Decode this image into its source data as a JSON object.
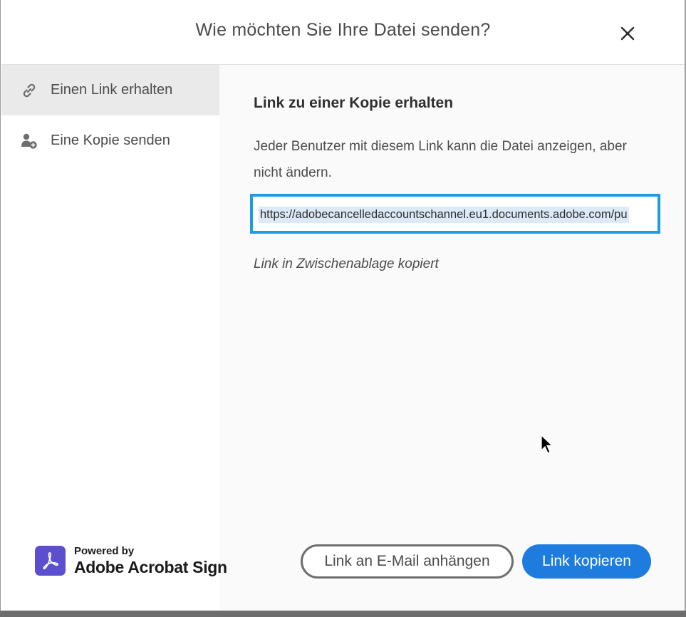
{
  "dialog": {
    "title": "Wie möchten Sie Ihre Datei senden?",
    "close_icon": "close-icon"
  },
  "sidebar": {
    "items": [
      {
        "label": "Einen Link erhalten",
        "icon": "link-icon",
        "active": true
      },
      {
        "label": "Eine Kopie senden",
        "icon": "add-user-icon",
        "active": false
      }
    ]
  },
  "main": {
    "heading": "Link zu einer Kopie erhalten",
    "description": "Jeder Benutzer mit diesem Link kann die Datei anzeigen, aber nicht ändern.",
    "link_value": "https://adobecancelledaccountschannel.eu1.documents.adobe.com/pu",
    "status": "Link in Zwischenablage kopiert"
  },
  "branding": {
    "powered_by": "Powered by",
    "product": "Adobe Acrobat Sign",
    "logo_color": "#5b4fcf"
  },
  "buttons": {
    "attach_email": "Link an E-Mail anhängen",
    "copy_link": "Link kopieren"
  },
  "colors": {
    "accent": "#1f7cdf",
    "focus_border": "#1c9ce3"
  }
}
